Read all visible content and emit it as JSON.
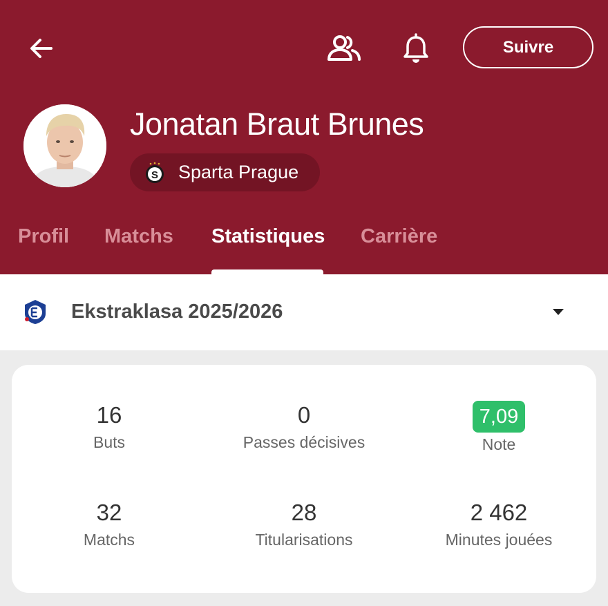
{
  "header": {
    "follow_label": "Suivre",
    "player_name": "Jonatan Braut Brunes",
    "club_name": "Sparta Prague",
    "club_logo_letter": "S"
  },
  "tabs": [
    {
      "label": "Profil",
      "active": false
    },
    {
      "label": "Matchs",
      "active": false
    },
    {
      "label": "Statistiques",
      "active": true
    },
    {
      "label": "Carrière",
      "active": false
    }
  ],
  "league": {
    "name": "Ekstraklasa 2025/2026"
  },
  "stats": [
    {
      "value": "16",
      "label": "Buts"
    },
    {
      "value": "0",
      "label": "Passes décisives"
    },
    {
      "value": "7,09",
      "label": "Note",
      "badge": true
    },
    {
      "value": "32",
      "label": "Matchs"
    },
    {
      "value": "28",
      "label": "Titularisations"
    },
    {
      "value": "2 462",
      "label": "Minutes jouées"
    }
  ],
  "colors": {
    "header_bg": "#8b1a2d",
    "rating_badge": "#2fbf6a"
  },
  "icons": [
    "back-arrow-icon",
    "people-icon",
    "bell-icon",
    "sparta-logo-icon",
    "ekstraklasa-logo-icon",
    "caret-down-icon"
  ]
}
